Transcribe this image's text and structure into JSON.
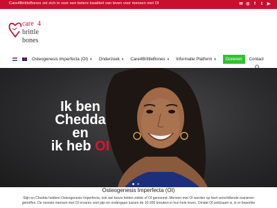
{
  "topbar": {
    "text": "Care4BrittleBones zet zich in voor een betere kwaliteit van leven voor mensen met OI",
    "social_icons": [
      "mail-icon",
      "instagram-icon",
      "facebook-icon",
      "twitter-icon",
      "youtube-icon"
    ]
  },
  "logo": {
    "word1": "care",
    "word_num": "4",
    "word2": "brittle",
    "word3": "bones",
    "brand_color": "#c8102e"
  },
  "nav": {
    "flags": [
      "flag-nl-icon",
      "flag-uk-icon"
    ],
    "items": [
      {
        "label": "Osteogenesis Imperfecta (OI)",
        "dropdown": true
      },
      {
        "label": "Onderzoek",
        "dropdown": true
      },
      {
        "label": "Care4BrittleBones",
        "dropdown": true
      },
      {
        "label": "Informatie Platform",
        "dropdown": true
      }
    ],
    "donate_label": "Doneren",
    "contact_label": "Contact",
    "donate_color": "#2ec32e"
  },
  "hero": {
    "line1": "Ik ben",
    "line2": "Chedda en",
    "line3": "ik heb ",
    "line3_highlight": "OI",
    "highlight_color": "#e0122f",
    "slides_total": 2,
    "slide_active": 1
  },
  "section": {
    "title": "Osteogenesis Imperfecta (OI)",
    "intro": "Stijn en Chedda hebben Osteogenesis Imperfecta, ook wel broze botten ziekte of OI genoemd. Mensen met OI worden op heel verschillende manieren getroffen. De meeste mensen met OI ervaren veel pijn en ondergaan tussen de 10-300 breuken in hun hele leven. Omdat OI zeldzaam is, is er beperkte"
  }
}
